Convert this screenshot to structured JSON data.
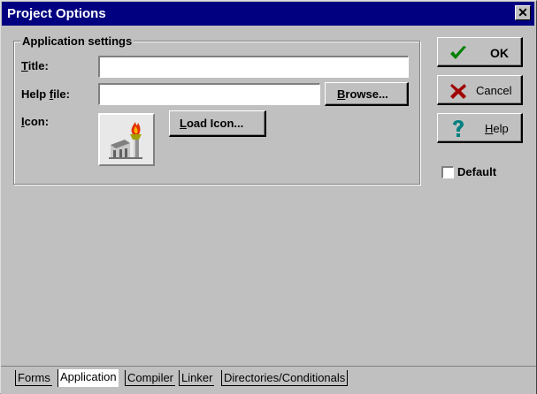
{
  "window": {
    "title": "Project Options",
    "close_glyph": "✕"
  },
  "group": {
    "label": "Application settings",
    "title_label_prefix": "T",
    "title_label_rest": "itle:",
    "title_value": "",
    "helpfile_label_prefix": "Help ",
    "helpfile_label_u": "f",
    "helpfile_label_rest": "ile:",
    "helpfile_value": "",
    "browse_prefix": "B",
    "browse_rest": "rowse...",
    "icon_label_prefix": "I",
    "icon_label_rest": "con:",
    "load_icon_prefix": "L",
    "load_icon_rest": "oad Icon..."
  },
  "buttons": {
    "ok": "OK",
    "cancel": "Cancel",
    "help_prefix": "H",
    "help_rest": "elp",
    "default_label": "Default"
  },
  "colors": {
    "ok_check": "#008000",
    "cancel_x": "#a00000",
    "help_q": "#008080",
    "title_bg": "#000080"
  },
  "tabs": [
    {
      "label": "Forms",
      "active": false
    },
    {
      "label": "Application",
      "active": true
    },
    {
      "label": "Compiler",
      "active": false
    },
    {
      "label": "Linker",
      "active": false
    },
    {
      "label": "Directories/Conditionals",
      "active": false
    }
  ]
}
